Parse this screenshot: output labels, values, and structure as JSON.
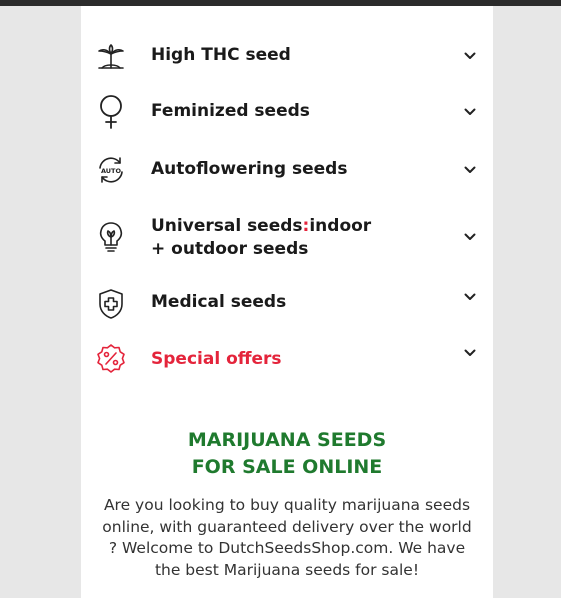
{
  "menu": {
    "items": [
      {
        "label": "High THC seed",
        "icon": "palm-island-icon"
      },
      {
        "label": "Feminized seeds",
        "icon": "female-symbol-icon"
      },
      {
        "label": "Autoflowering seeds",
        "icon": "auto-cycle-icon",
        "icon_text": "AUTO"
      },
      {
        "label_line1_a": "Universal seeds",
        "label_line1_sep": ":",
        "label_line1_b": "indoor",
        "label_line2": "+ outdoor seeds",
        "icon": "lightbulb-icon"
      },
      {
        "label": "Medical seeds",
        "icon": "medical-shield-icon"
      },
      {
        "label": "Special offers",
        "icon": "percent-badge-icon"
      }
    ]
  },
  "colors": {
    "accent_red": "#e4243b",
    "heading_green": "#1f7a2e",
    "text_dark": "#1a1a1a",
    "background": "#e7e7e7"
  },
  "heading": {
    "line1": "MARIJUANA SEEDS",
    "line2": "FOR SALE ONLINE"
  },
  "intro": {
    "text": "Are you looking to buy quality marijuana seeds online, with guaranteed delivery over the world ? Welcome to DutchSeedsShop.com. We have the best Marijuana seeds for sale!"
  }
}
